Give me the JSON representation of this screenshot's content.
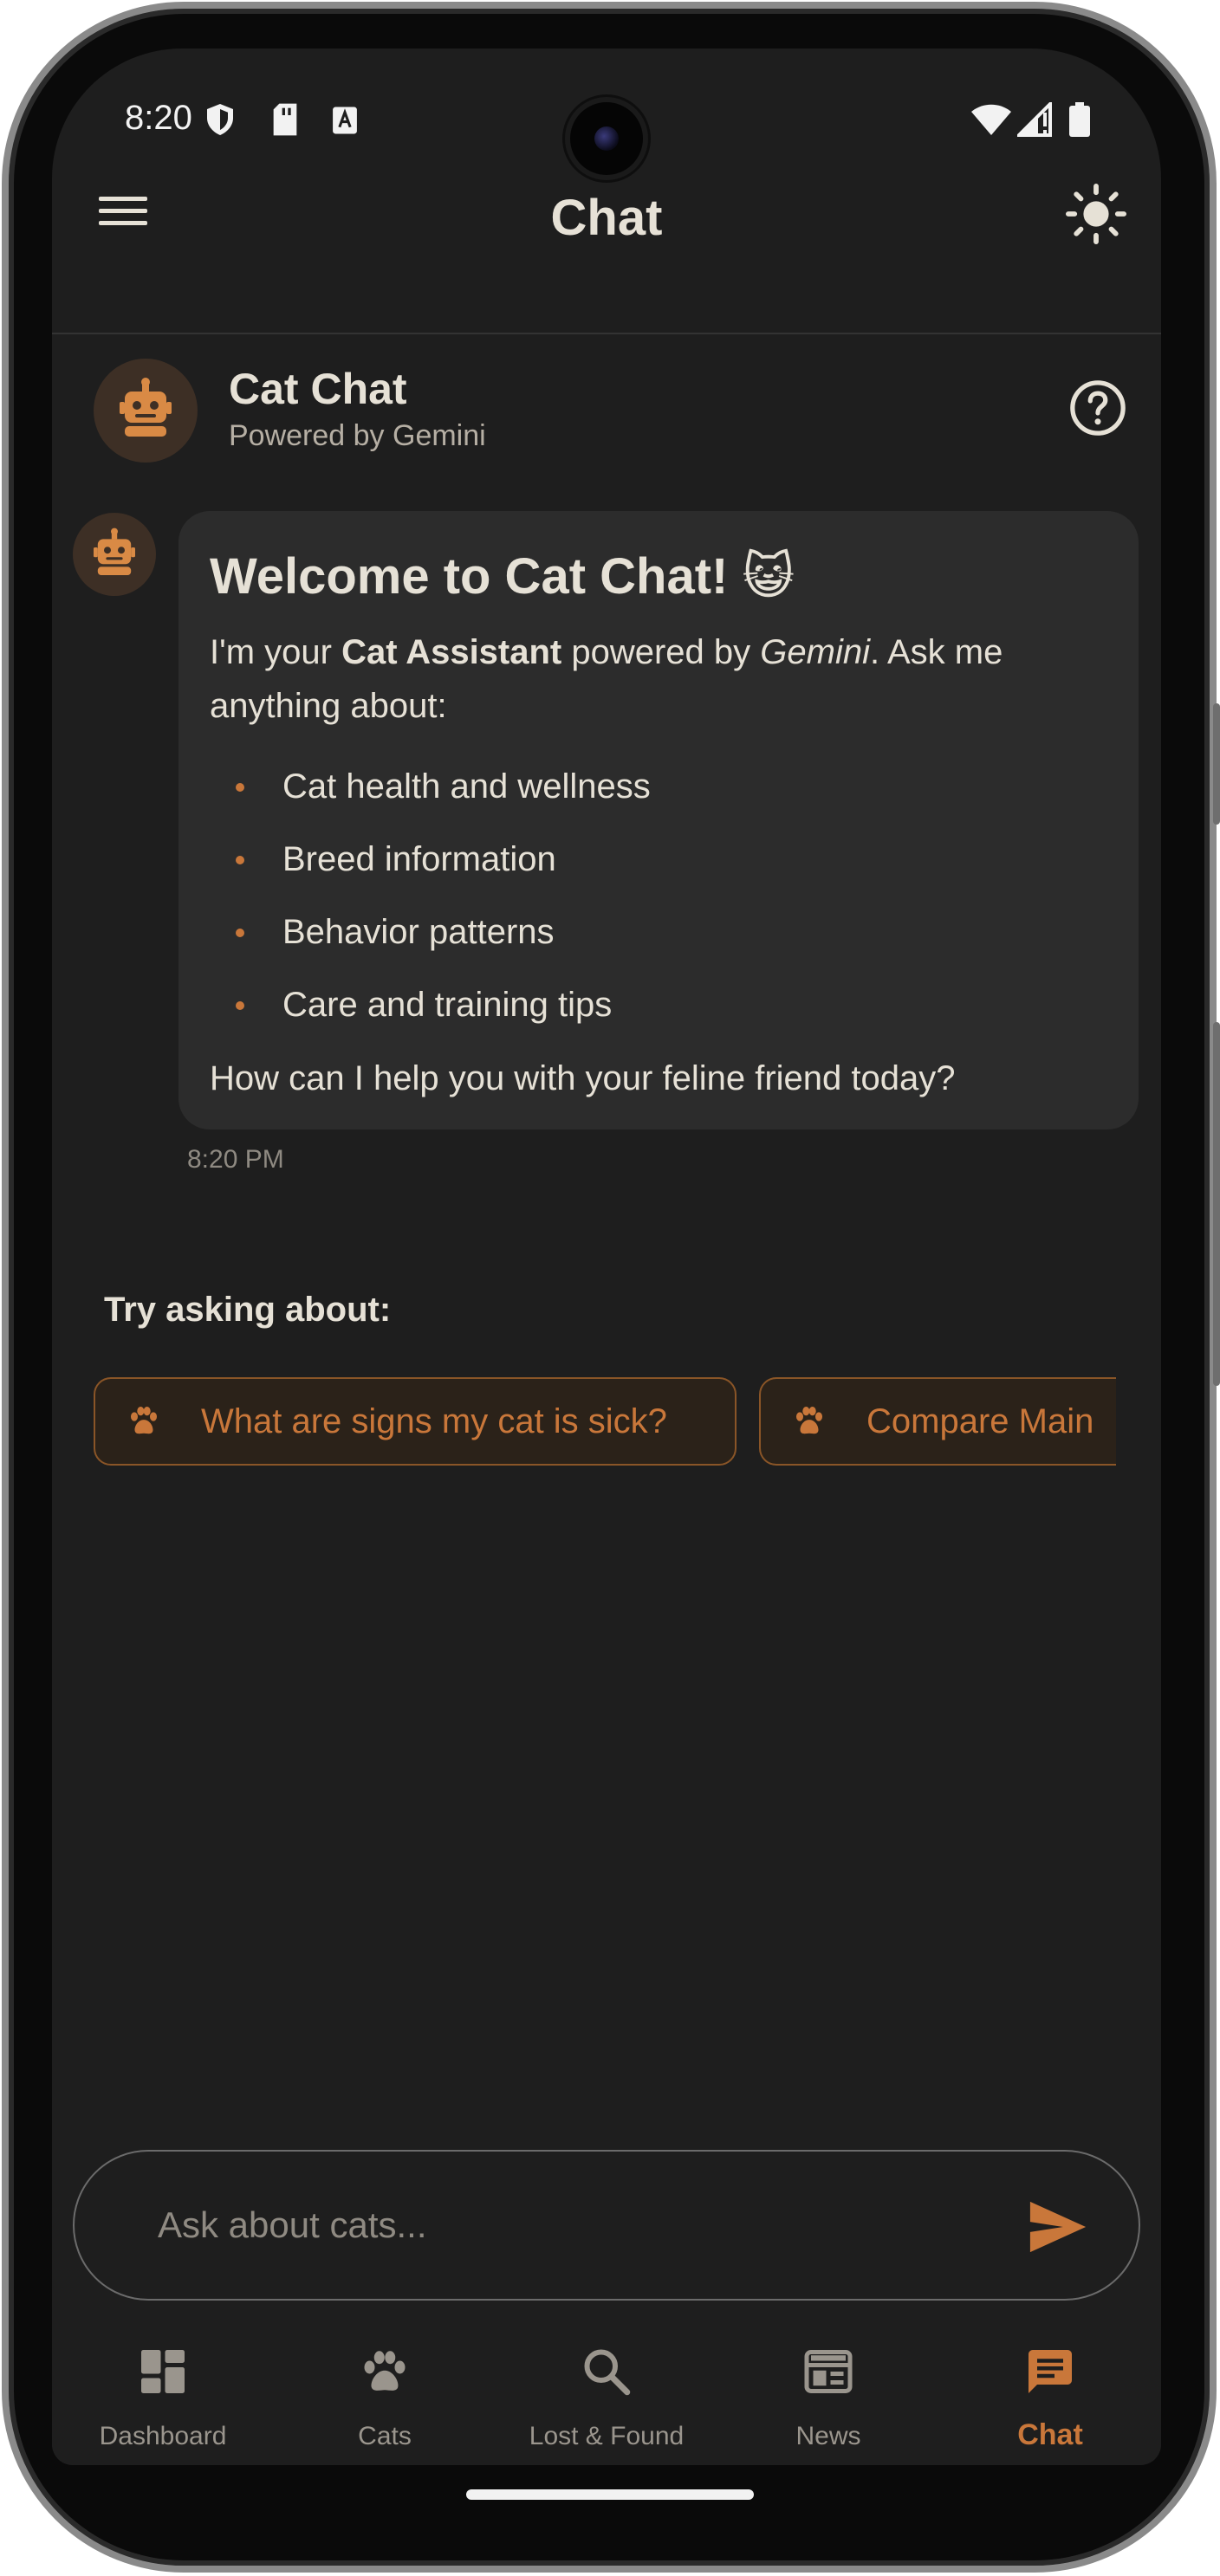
{
  "status_bar": {
    "time": "8:20"
  },
  "app_bar": {
    "title": "Chat"
  },
  "chat_header": {
    "name": "Cat Chat",
    "subtitle": "Powered by Gemini"
  },
  "message": {
    "title": "Welcome to Cat Chat! 😺",
    "intro_prefix": "I'm your ",
    "intro_bold": "Cat Assistant",
    "intro_mid": " powered by ",
    "intro_italic": "Gemini",
    "intro_suffix": ". Ask me anything about:",
    "topics": [
      "Cat health and wellness",
      "Breed information",
      "Behavior patterns",
      "Care and training tips"
    ],
    "closing": "How can I help you with your feline friend today?",
    "time": "8:20 PM"
  },
  "suggestions": {
    "label": "Try asking about:",
    "chips": [
      "What are signs my cat is sick?",
      "Compare Main"
    ]
  },
  "input": {
    "placeholder": "Ask about cats..."
  },
  "bottom_nav": {
    "items": [
      {
        "label": "Dashboard",
        "icon": "dashboard-icon"
      },
      {
        "label": "Cats",
        "icon": "paw-icon"
      },
      {
        "label": "Lost & Found",
        "icon": "search-icon"
      },
      {
        "label": "News",
        "icon": "newspaper-icon"
      },
      {
        "label": "Chat",
        "icon": "chat-icon"
      }
    ],
    "active": "Chat"
  },
  "colors": {
    "accent": "#c9773a",
    "background": "#1e1e1e",
    "bubble": "#2c2c2c",
    "text": "#e6e1d6"
  }
}
